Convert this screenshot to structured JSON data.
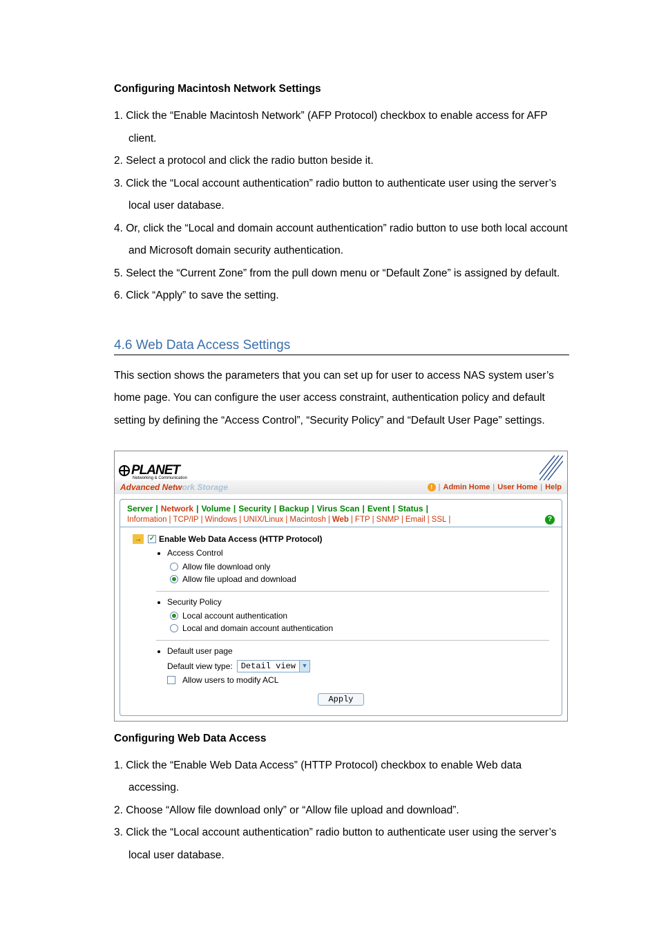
{
  "macSection": {
    "heading": "Configuring Macintosh Network Settings",
    "steps": [
      "1. Click the “Enable Macintosh Network” (AFP Protocol) checkbox to enable access for AFP client.",
      "2. Select a protocol and click the radio button beside it.",
      "3. Click the “Local account authentication” radio button to authenticate user using the server’s local user database.",
      "4. Or, click the “Local and domain account authentication” radio button to use both local account and Microsoft domain security authentication.",
      "5. Select the “Current Zone” from the pull down menu or “Default Zone” is assigned by default.",
      "6. Click “Apply” to save the setting."
    ]
  },
  "sectionTitle": "4.6 Web Data Access Settings",
  "sectionIntro": "This section shows the parameters that you can set up for user to access NAS system user’s home page. You can configure the user access constraint, authentication policy and default setting by defining the “Access Control”, “Security Policy” and “Default User Page” settings.",
  "panel": {
    "brand": {
      "name": "PLANET",
      "subtitle": "Networking & Communication"
    },
    "productName": {
      "bold": "Advanced Netw",
      "light": "ork Storage"
    },
    "topLinks": {
      "admin": "Admin Home",
      "user": "User Home",
      "help": "Help"
    },
    "primaryTabs": [
      "Server",
      "Network",
      "Volume",
      "Security",
      "Backup",
      "Virus Scan",
      "Event",
      "Status"
    ],
    "primaryActive": "Network",
    "secondaryTabs": [
      "Information",
      "TCP/IP",
      "Windows",
      "UNIX/Linux",
      "Macintosh",
      "Web",
      "FTP",
      "SNMP",
      "Email",
      "SSL"
    ],
    "secondaryActive": "Web",
    "enableLabel": "Enable Web Data Access (HTTP Protocol)",
    "accessControl": {
      "title": "Access Control",
      "opt1": "Allow file download only",
      "opt2": "Allow file upload and download"
    },
    "securityPolicy": {
      "title": "Security Policy",
      "opt1": "Local account authentication",
      "opt2": "Local and domain account authentication"
    },
    "defaultUserPage": {
      "title": "Default user page",
      "label": "Default view type:",
      "select": "Detail view",
      "acl": "Allow users to modify ACL"
    },
    "applyBtn": "Apply"
  },
  "webSection": {
    "heading": "Configuring Web Data Access",
    "steps": [
      "1. Click the “Enable Web Data Access” (HTTP Protocol) checkbox to enable Web data accessing.",
      "2. Choose “Allow file download only” or “Allow file upload and download”.",
      "3. Click the “Local account authentication” radio button to authenticate user using the server’s local user database."
    ]
  }
}
